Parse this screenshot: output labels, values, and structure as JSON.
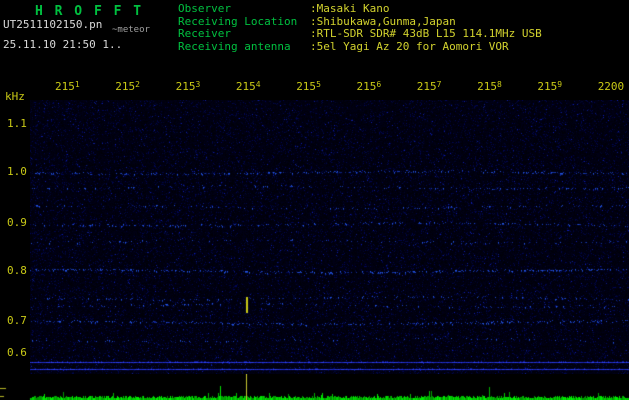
{
  "colors": {
    "bg": "#000000",
    "green": "#00c040",
    "yellow": "#d2d22e",
    "white": "#d9d9d9",
    "gray": "#a0a0a0",
    "axis-yellow": "#c9c916"
  },
  "header": {
    "app_title": "H R O F F T",
    "file_name": "UT2511102150.pn",
    "file_note": "~meteor",
    "datetime": "25.11.10 21:50   1..",
    "info": [
      {
        "label": "Observer",
        "value": ":Masaki Kano"
      },
      {
        "label": "Receiving Location",
        "value": ":Shibukawa,Gunma,Japan"
      },
      {
        "label": "Receiver",
        "value": ":RTL-SDR SDR# 43dB L15 114.1MHz USB"
      },
      {
        "label": "Receiving antenna",
        "value": ":5el Yagi Az 20 for Aomori VOR"
      }
    ]
  },
  "chart_data": {
    "type": "heatmap",
    "title": "HROFFT radio meteor spectrogram, 21:50-22:00 UT, 2025-11-10",
    "ylabel": "kHz",
    "y_ticks": [
      "1.1",
      "1.0",
      "0.9",
      "0.8",
      "0.7",
      "0.6"
    ],
    "ylim": [
      0.6,
      1.15
    ],
    "x_range_minutes": 10,
    "x_tick_labels": [
      {
        "main": "215",
        "sup": "1"
      },
      {
        "main": "215",
        "sup": "2"
      },
      {
        "main": "215",
        "sup": "3"
      },
      {
        "main": "215",
        "sup": "4"
      },
      {
        "main": "215",
        "sup": "5"
      },
      {
        "main": "215",
        "sup": "6"
      },
      {
        "main": "215",
        "sup": "7"
      },
      {
        "main": "215",
        "sup": "8"
      },
      {
        "main": "215",
        "sup": "9"
      },
      {
        "main": "2200",
        "sup": ""
      }
    ],
    "carriers_khz": [
      {
        "freq": 1.0,
        "intensity": 0.4
      },
      {
        "freq": 0.97,
        "intensity": 0.18
      },
      {
        "freq": 0.93,
        "intensity": 0.15
      },
      {
        "freq": 0.895,
        "intensity": 0.28
      },
      {
        "freq": 0.86,
        "intensity": 0.12
      },
      {
        "freq": 0.8,
        "intensity": 0.45
      },
      {
        "freq": 0.745,
        "intensity": 0.18
      },
      {
        "freq": 0.73,
        "intensity": 0.15
      },
      {
        "freq": 0.695,
        "intensity": 0.4
      },
      {
        "freq": 0.66,
        "intensity": 0.12
      },
      {
        "freq": 0.615,
        "intensity": 0.95,
        "solid": true
      },
      {
        "freq": 0.6,
        "intensity": 0.85,
        "solid": true
      }
    ],
    "event_marker": {
      "time_min": 3.6,
      "freq_khz": 0.73,
      "color": "#c9c916"
    },
    "noise_floor_color": "#000008",
    "trace_color": "#2a3cc8",
    "level_strip": {
      "trace_color": "#00b400",
      "spike_time_min": 3.6,
      "spike_color": "#c8c832",
      "gutter_mark_color": "#b8b824"
    }
  }
}
